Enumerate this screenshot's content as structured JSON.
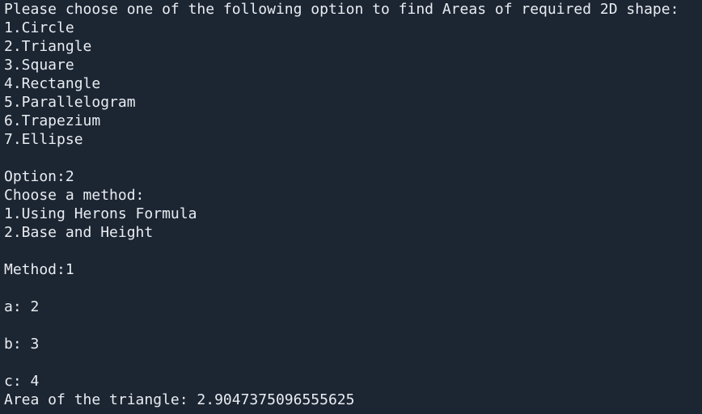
{
  "terminal": {
    "lines": [
      "Please choose one of the following option to find Areas of required 2D shape:",
      "1.Circle",
      "2.Triangle",
      "3.Square",
      "4.Rectangle",
      "5.Parallelogram",
      "6.Trapezium",
      "7.Ellipse",
      "",
      "Option:2",
      "Choose a method:",
      "1.Using Herons Formula",
      "2.Base and Height",
      "",
      "Method:1",
      "",
      "a: 2",
      "",
      "b: 3",
      "",
      "c: 4",
      "Area of the triangle: 2.9047375096555625"
    ]
  }
}
